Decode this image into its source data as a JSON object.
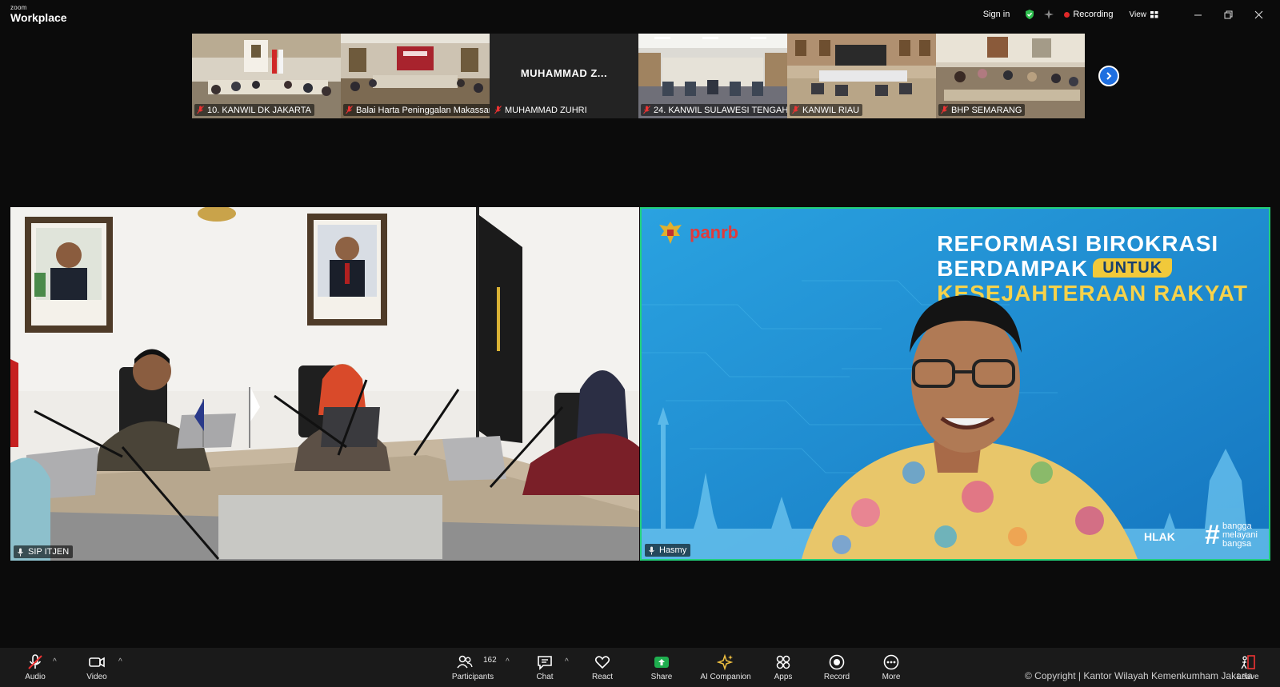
{
  "titlebar": {
    "brand_top": "zoom",
    "brand_main": "Workplace",
    "signin": "Sign in",
    "recording": "Recording",
    "view": "View"
  },
  "filmstrip": {
    "tiles": [
      {
        "label": "10. KANWIL DK JAKARTA"
      },
      {
        "label": "Balai Harta Peninggalan Makassar"
      },
      {
        "label": "MUHAMMAD ZUHRI",
        "display_name": "MUHAMMAD  Z..."
      },
      {
        "label": "24. KANWIL SULAWESI TENGAH"
      },
      {
        "label": "KANWIL RIAU"
      },
      {
        "label": "BHP SEMARANG"
      }
    ]
  },
  "main": {
    "left_label": "SIP ITJEN",
    "right_label": "Hasmy",
    "slide": {
      "logo": "panrb",
      "line1": "REFORMASI BIROKRASI",
      "line2": "BERDAMPAK",
      "highlight": "UNTUK",
      "line3": "KESEJAHTERAAN RAKYAT",
      "akhlak": "HLAK",
      "hashtag_1": "bangga",
      "hashtag_2": "melayani",
      "hashtag_3": "bangsa"
    }
  },
  "toolbar": {
    "audio": "Audio",
    "video": "Video",
    "participants": "Participants",
    "participant_count": "162",
    "chat": "Chat",
    "react": "React",
    "share": "Share",
    "ai_companion": "AI Companion",
    "apps": "Apps",
    "record": "Record",
    "more": "More",
    "leave": "Leave"
  },
  "watermark": "© Copyright | Kantor Wilayah Kemenkumham Jakarta",
  "colors": {
    "background": "#0b0b0b",
    "toolbar": "#1a1a1a",
    "active_speaker_border": "#22d07a",
    "share_green": "#1fae4f",
    "recording_red": "#e02828",
    "slide_blue": "#1d8fd4"
  }
}
